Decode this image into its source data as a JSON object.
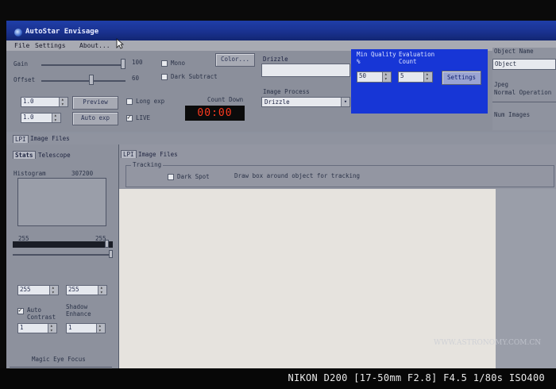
{
  "window": {
    "title": "AutoStar Envisage"
  },
  "menu": [
    "File",
    "Settings",
    "About..."
  ],
  "toolbar": {
    "gain_label": "Gain",
    "gain_value": "100",
    "offset_label": "Offset",
    "offset_value": "60",
    "mono_label": "Mono",
    "dark_subtract_label": "Dark Subtract",
    "color_button": "Color...",
    "drizzle_label": "Drizzle",
    "image_process_label": "Image Process",
    "image_process_value": "Drizzle",
    "exposure_1": "1.0",
    "exposure_2": "1.0",
    "preview_button": "Preview",
    "auto_exp_button": "Auto exp",
    "long_exp_label": "Long exp",
    "live_label": "LIVE",
    "countdown_label": "Count Down",
    "countdown_value": "00:00",
    "min_quality_label": "Min Quality",
    "min_quality_unit": "%",
    "min_quality_value": "50",
    "evaluation_count_label": "Evaluation Count",
    "evaluation_count_value": "5",
    "settings_button": "Settings",
    "object_name_label": "Object Name",
    "object_name_value": "Object",
    "jpeg_label": "Jpeg",
    "jpeg_value": "Normal Operation",
    "num_images_label": "Num Images"
  },
  "tabs_top": [
    "LPI",
    "Image Files"
  ],
  "left": {
    "tabs": [
      "Stats",
      "Telescope"
    ],
    "histogram_label": "Histogram",
    "histogram_count": "307200",
    "level_low": "255",
    "level_high": "255",
    "spin_a": "255",
    "spin_b": "255",
    "auto_contrast_label": "Auto Contrast",
    "shadow_enhance_label": "Shadow Enhance",
    "spin_c": "1",
    "spin_d": "1",
    "magic_eye_label": "Magic Eye Focus"
  },
  "right": {
    "tabs": [
      "LPI",
      "Image Files"
    ],
    "tracking_label": "Tracking",
    "dark_spot_label": "Dark Spot",
    "tracking_hint": "Draw box around object for tracking"
  },
  "photo": {
    "watermark": "WWW.ASTRONOMY.COM.CN",
    "caption": "NIKON D200 [17-50mm F2.8] F4.5 1/80s ISO400"
  }
}
